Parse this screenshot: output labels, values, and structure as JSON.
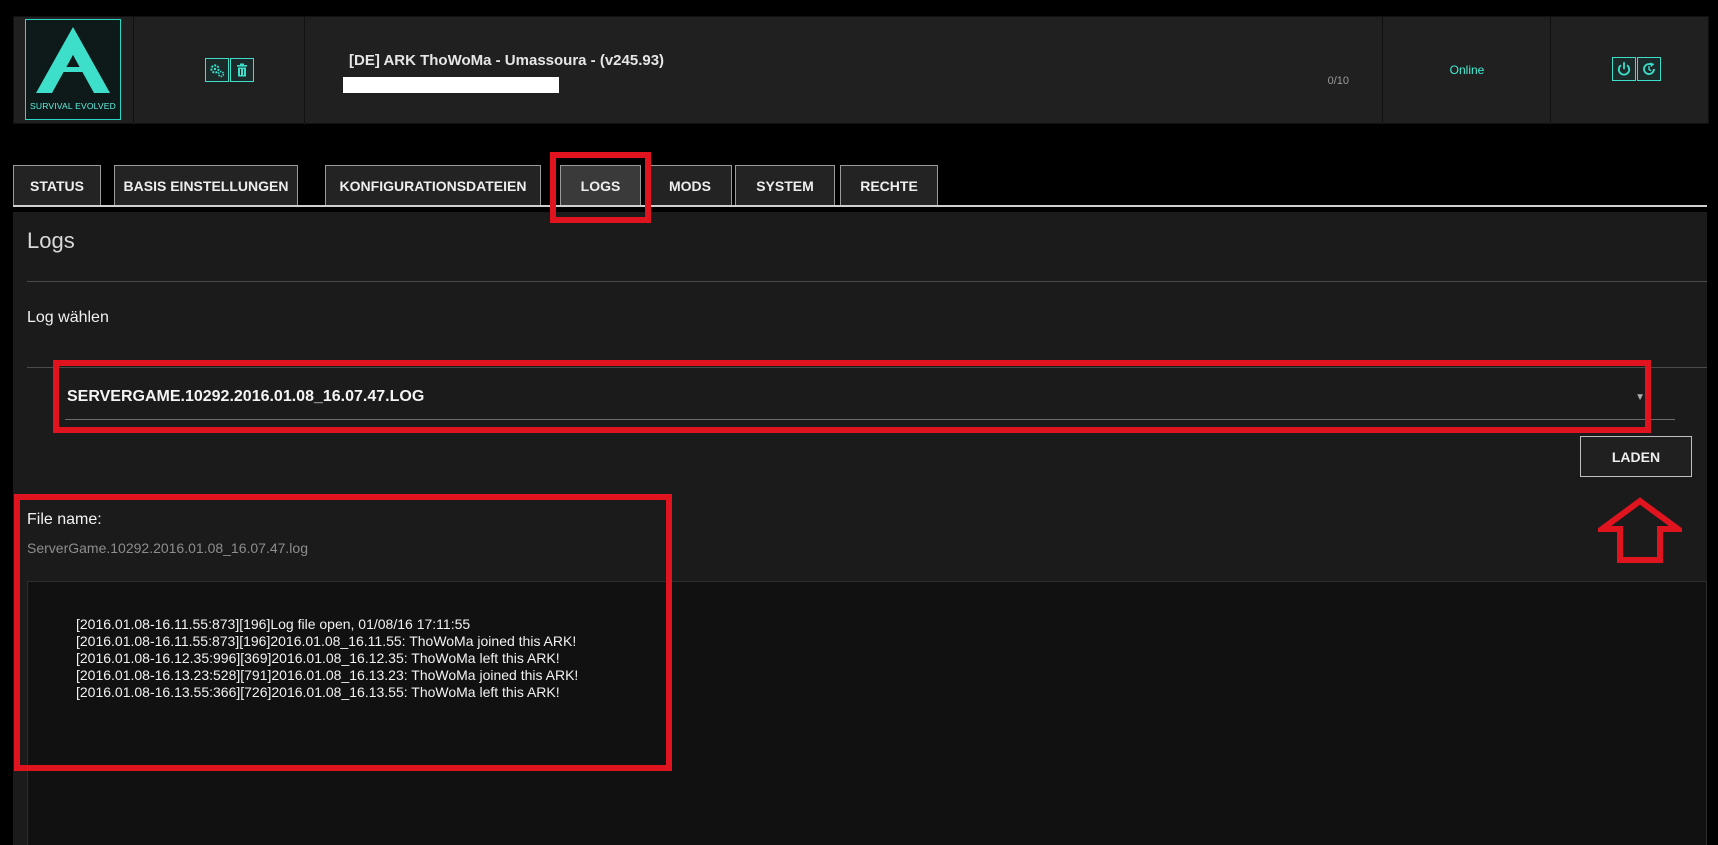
{
  "server": {
    "logo_text": "SURVIVAL EVOLVED",
    "name": "[DE] ARK ThoWoMa - Umassoura - (v245.93)",
    "players": "0/10",
    "status": "Online",
    "accent_color": "#3ddfcb",
    "status_color": "#41f0d6",
    "config_icons": [
      "settings-gears-icon",
      "trash-icon"
    ],
    "power_icons": [
      "power-icon",
      "restart-icon"
    ]
  },
  "tabs": [
    {
      "label": "STATUS"
    },
    {
      "label": "BASIS EINSTELLUNGEN"
    },
    {
      "label": "KONFIGURATIONSDATEIEN"
    },
    {
      "label": "LOGS",
      "active": true
    },
    {
      "label": "MODS"
    },
    {
      "label": "SYSTEM"
    },
    {
      "label": "RECHTE"
    }
  ],
  "logs": {
    "title": "Logs",
    "select_label": "Log wählen",
    "selected_log": "SERVERGAME.10292.2016.01.08_16.07.47.LOG",
    "load_button": "LADEN",
    "file_name_label": "File name:",
    "file_name": "ServerGame.10292.2016.01.08_16.07.47.log",
    "lines": [
      "[2016.01.08-16.11.55:873][196]Log file open, 01/08/16 17:11:55",
      "[2016.01.08-16.11.55:873][196]2016.01.08_16.11.55: ThoWoMa joined this ARK!",
      "[2016.01.08-16.12.35:996][369]2016.01.08_16.12.35: ThoWoMa left this ARK!",
      "[2016.01.08-16.13.23:528][791]2016.01.08_16.13.23: ThoWoMa joined this ARK!",
      "[2016.01.08-16.13.55:366][726]2016.01.08_16.13.55: ThoWoMa left this ARK!"
    ]
  },
  "annotation_color": "#e0141e"
}
